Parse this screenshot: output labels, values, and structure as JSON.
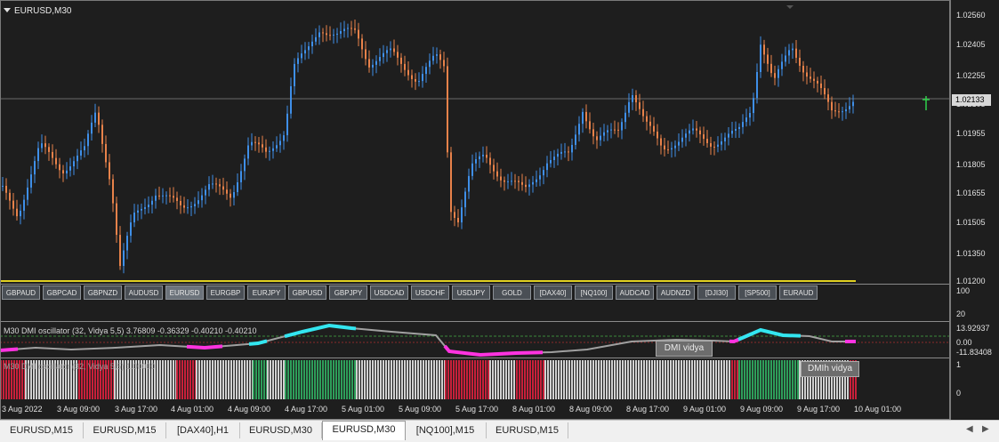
{
  "window": {
    "title": "EURUSD,M30"
  },
  "price_axis": {
    "labels": [
      "1.02560",
      "1.02405",
      "1.02255",
      "1.02105",
      "1.01955",
      "1.01805",
      "1.01655",
      "1.01505",
      "1.01350",
      "1.01200"
    ],
    "current_price": "1.02133"
  },
  "symbols": [
    "GBPAUD",
    "GBPCAD",
    "GBPNZD",
    "AUDUSD",
    "EURUSD",
    "EURGBP",
    "EURJPY",
    "GBPUSD",
    "GBPJPY",
    "USDCAD",
    "USDCHF",
    "USDJPY",
    "GOLD",
    "[DAX40]",
    "[NQ100]",
    "AUDCAD",
    "AUDNZD",
    "[DJI30]",
    "[SP500]",
    "EURAUD"
  ],
  "active_symbol": "EURUSD",
  "panel1_axis": [
    "100",
    "20"
  ],
  "panel2": {
    "label": "M30 DMI oscillator (32, Vidya 5,5) 3.76809 -0.36329 -0.40210 -0.40210",
    "axis": [
      "13.92937",
      "0.00",
      "-11.83408"
    ],
    "button": "DMI vidya"
  },
  "panel3": {
    "label": "M30 DMI oscillator (32, Vidya 5,5) 1.00000",
    "axis": [
      "1",
      "0"
    ],
    "button": "DMIh vidya"
  },
  "time_axis": [
    "3 Aug 2022",
    "3 Aug 09:00",
    "3 Aug 17:00",
    "4 Aug 01:00",
    "4 Aug 09:00",
    "4 Aug 17:00",
    "5 Aug 01:00",
    "5 Aug 09:00",
    "5 Aug 17:00",
    "8 Aug 01:00",
    "8 Aug 09:00",
    "8 Aug 17:00",
    "9 Aug 01:00",
    "9 Aug 09:00",
    "9 Aug 17:00",
    "10 Aug 01:00"
  ],
  "tabs": [
    "EURUSD,M15",
    "EURUSD,M15",
    "[DAX40],H1",
    "EURUSD,M30",
    "EURUSD,M30",
    "[NQ100],M15",
    "EURUSD,M15"
  ],
  "active_tab_index": 4,
  "colors": {
    "bull": "#3f8fe8",
    "bear": "#e8824a",
    "cyan": "#33e6f0",
    "magenta": "#ff33e0",
    "green": "#2e9e5a",
    "red": "#c8203a",
    "gray": "#d0d0d0"
  }
}
